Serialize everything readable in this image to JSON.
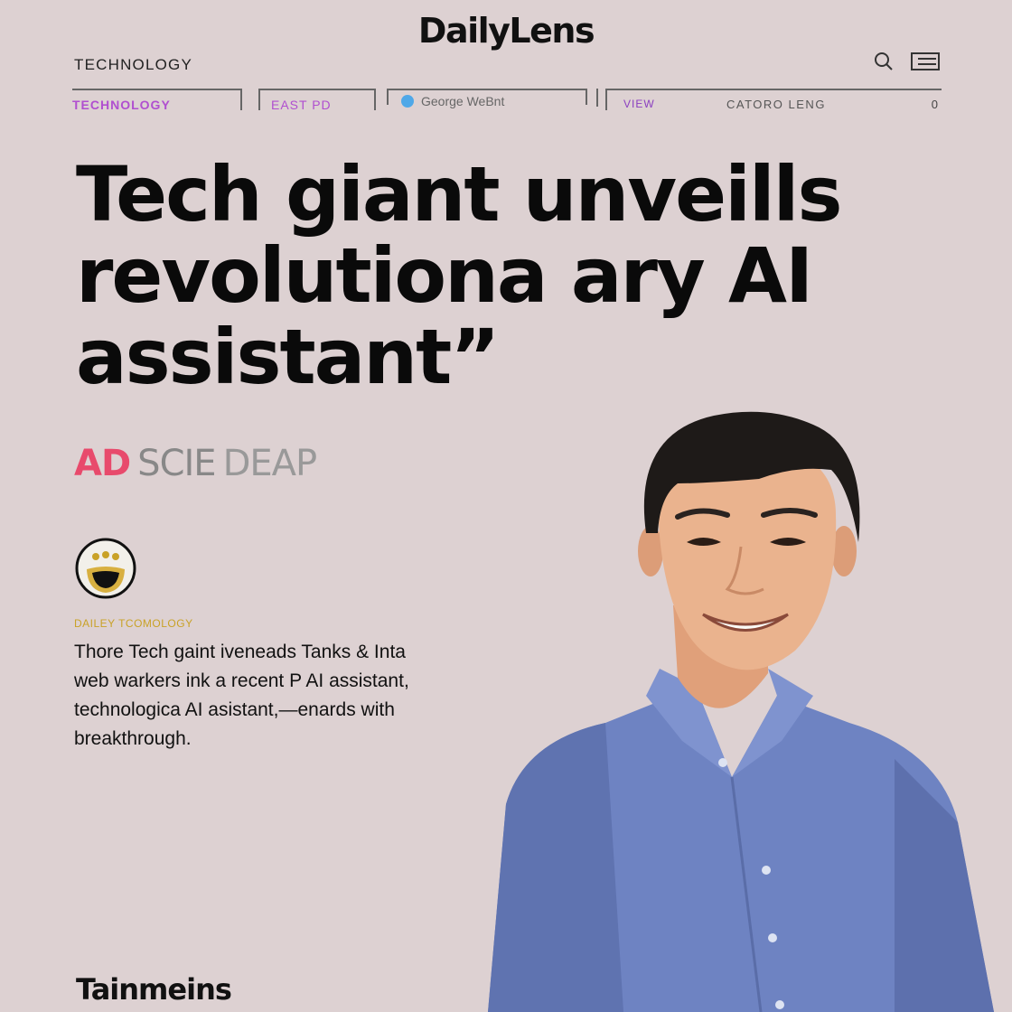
{
  "header": {
    "logo": "DailyLens",
    "section": "TECHNOLOGY",
    "icons": [
      "search-icon",
      "menu-icon"
    ]
  },
  "tabs": {
    "technology": "TECHNOLOGY",
    "east": "EAST PD",
    "search_text": "George WeBnt",
    "review": "VIEW",
    "category": "CATORO LENG",
    "count": "0"
  },
  "article": {
    "headline_lines": [
      "Tech giant unveills",
      "revolutiona ary AI",
      "assistant”"
    ],
    "subhead": {
      "w1": "AD",
      "w2": "SCIE",
      "w3": "DEAP"
    },
    "kicker": "DAILEY TCOMOLOGY",
    "body_lines": [
      "Thore Tech gaint iveneads Tanks & Inta",
      "web warkers ink a recent P AI assistant,",
      "technologica AI asistant,—enards with",
      "breakthrough."
    ],
    "byline": "Tainmeins"
  },
  "colors": {
    "background": "#ddd1d2",
    "accent_purple": "#b04fd0",
    "kicker_gold": "#c9a227",
    "shirt_blue": "#6e83c2"
  }
}
